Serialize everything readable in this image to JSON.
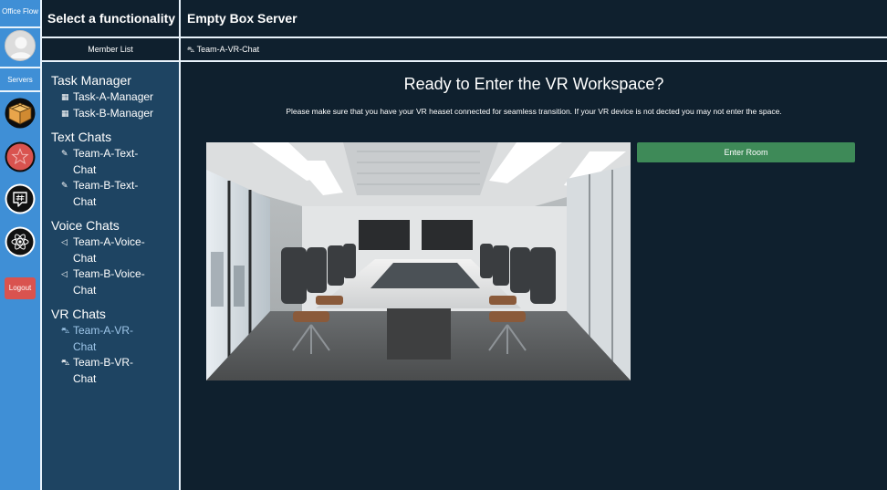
{
  "rail": {
    "brand": "Office Flow",
    "servers_label": "Servers",
    "servers": [
      {
        "icon": "box-icon",
        "color": "#e9a54b"
      },
      {
        "icon": "star-icon",
        "color": "#d9534f"
      },
      {
        "icon": "hashtag-chat-icon",
        "color": "#111111"
      },
      {
        "icon": "atom-icon",
        "color": "#111111"
      }
    ],
    "logout_label": "Logout"
  },
  "sidebar": {
    "title": "Select a functionality",
    "member_list_label": "Member List",
    "groups": [
      {
        "title": "Task Manager",
        "icon": "table-icon",
        "items": [
          "Task-A-Manager",
          "Task-B-Manager"
        ]
      },
      {
        "title": "Text Chats",
        "icon": "pencil-icon",
        "items": [
          "Team-A-Text-Chat",
          "Team-B-Text-Chat"
        ]
      },
      {
        "title": "Voice Chats",
        "icon": "megaphone-icon",
        "items": [
          "Team-A-Voice-Chat",
          "Team-B-Voice-Chat"
        ]
      },
      {
        "title": "VR Chats",
        "icon": "vr-headset-icon",
        "items": [
          "Team-A-VR-Chat",
          "Team-B-VR-Chat"
        ],
        "active": "Team-A-VR-Chat"
      }
    ]
  },
  "main": {
    "server_name": "Empty Box Server",
    "breadcrumb": "Team-A-VR-Chat",
    "heading": "Ready to Enter the VR Workspace?",
    "subtext": "Please make sure that you have your VR heaset connected for seamless transition. If your VR device is not dected you may not enter the space.",
    "enter_button": "Enter Room"
  },
  "colors": {
    "rail": "#3f8fd6",
    "sidebar": "#1e4462",
    "main": "#0f202e",
    "enter_button": "#3e8a58",
    "logout": "#d9534f",
    "active_channel": "#9fc7ea"
  }
}
